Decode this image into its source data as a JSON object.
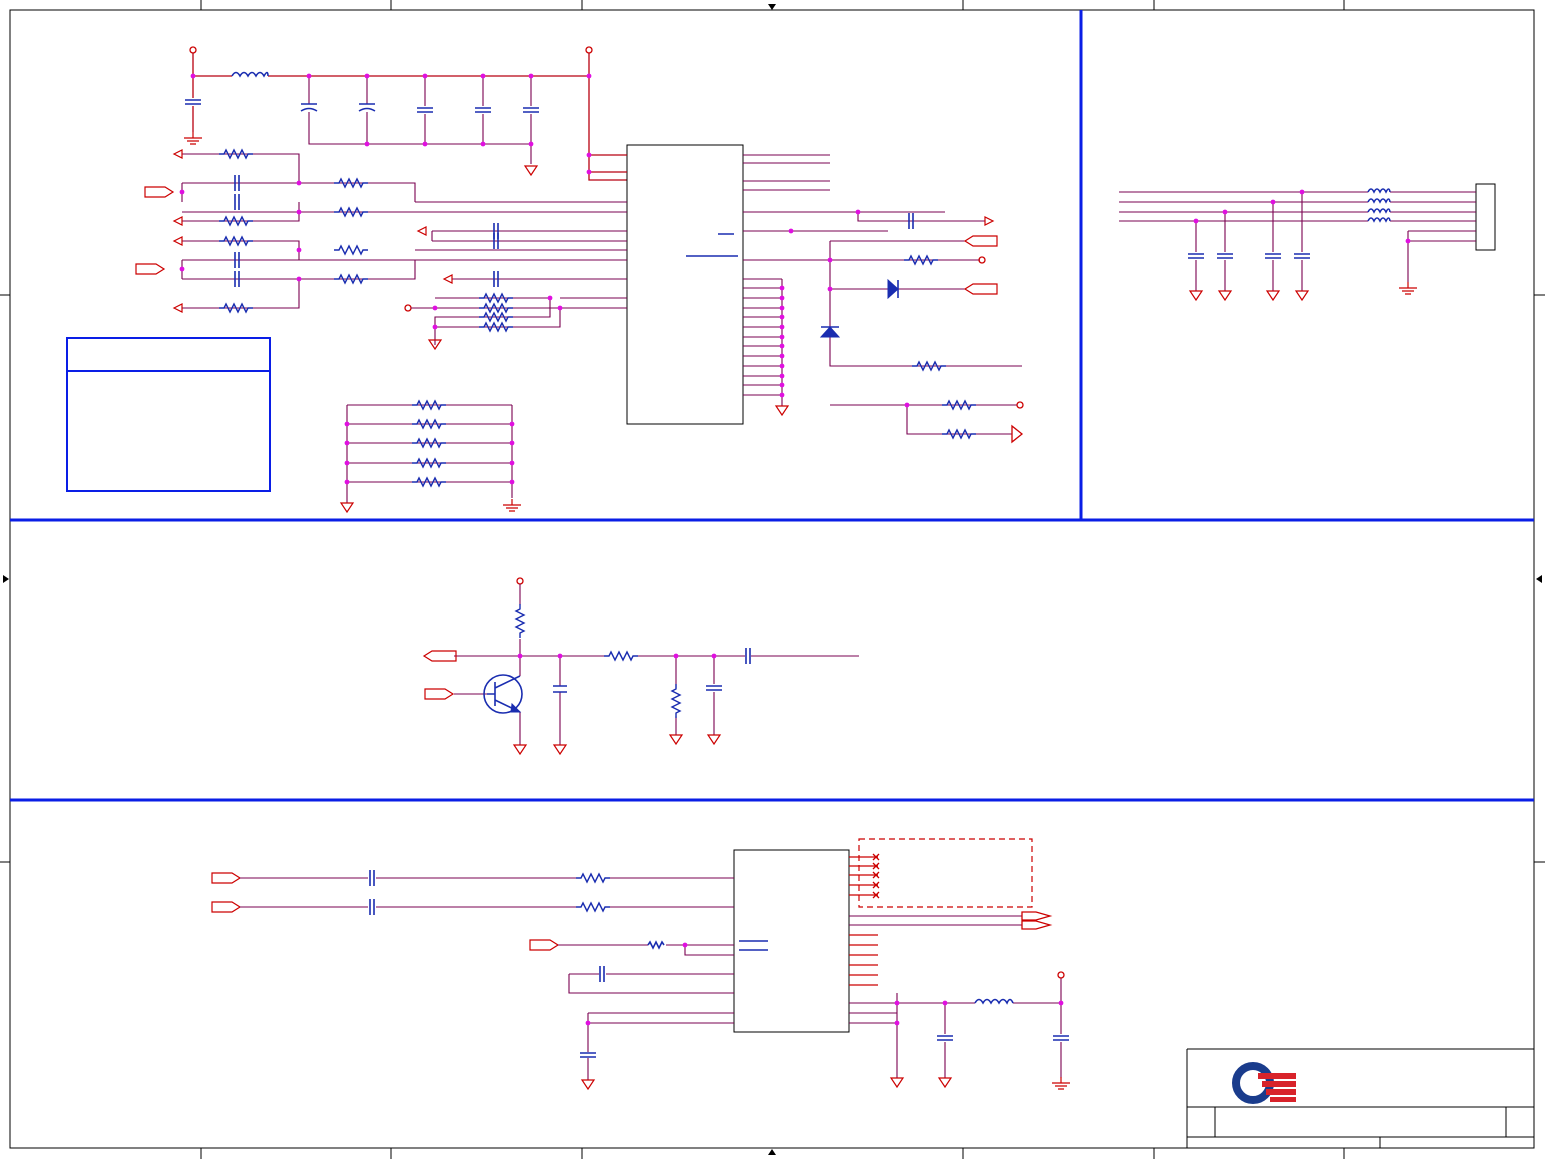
{
  "title_block": {
    "logo": "company-logo"
  },
  "colors": {
    "wire": "#b80010",
    "component": "#1a2db0",
    "section_border": "#0a1ee6",
    "junction": "#e010e0",
    "frame": "#000000",
    "logo_blue": "#1a3c8c",
    "logo_red": "#d8232a"
  }
}
